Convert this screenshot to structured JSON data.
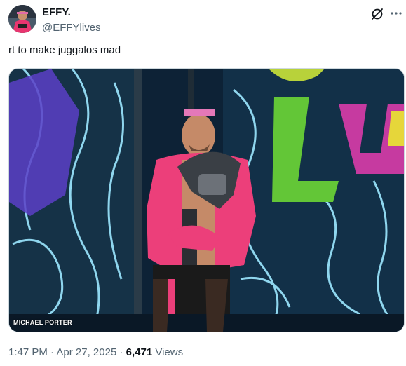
{
  "author": {
    "display_name": "EFFY.",
    "handle": "@EFFYlives"
  },
  "icons": {
    "grok": "grok-icon",
    "more": "more-icon"
  },
  "tweet": {
    "text": "rt to make juggalos mad"
  },
  "media": {
    "photo_credit": "MICHAEL PORTER"
  },
  "meta": {
    "time": "1:47 PM",
    "separator": "·",
    "date": "Apr 27, 2025",
    "views_count": "6,471",
    "views_label": "Views"
  },
  "colors": {
    "text_primary": "#0f1419",
    "text_secondary": "#536471",
    "border": "#cfd9de"
  }
}
